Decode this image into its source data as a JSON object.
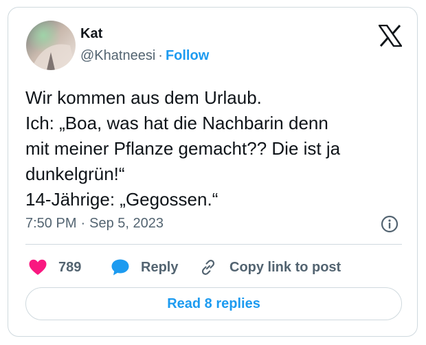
{
  "author": {
    "display_name": "Kat",
    "handle": "@Khatneesi",
    "separator": "·",
    "follow_label": "Follow"
  },
  "tweet": {
    "lines": [
      "Wir kommen aus dem Urlaub.",
      "Ich: „Boa, was hat die Nachbarin denn",
      "mit meiner Pflanze gemacht?? Die ist ja",
      "dunkelgrün!“",
      "14-Jährige: „Gegossen.“"
    ],
    "time": "7:50 PM",
    "meta_separator": "·",
    "date": "Sep 5, 2023"
  },
  "actions": {
    "like_count": "789",
    "reply_label": "Reply",
    "copy_link_label": "Copy link to post"
  },
  "footer": {
    "read_replies_label": "Read 8 replies"
  },
  "icons": {
    "logo": "x-logo-icon",
    "info": "info-icon",
    "like": "heart-icon",
    "reply": "speech-bubble-icon",
    "copy": "link-icon"
  },
  "colors": {
    "accent": "#1d9bf0",
    "like": "#f91880",
    "text": "#0f1419",
    "muted": "#536471",
    "border": "#cfd9de"
  }
}
